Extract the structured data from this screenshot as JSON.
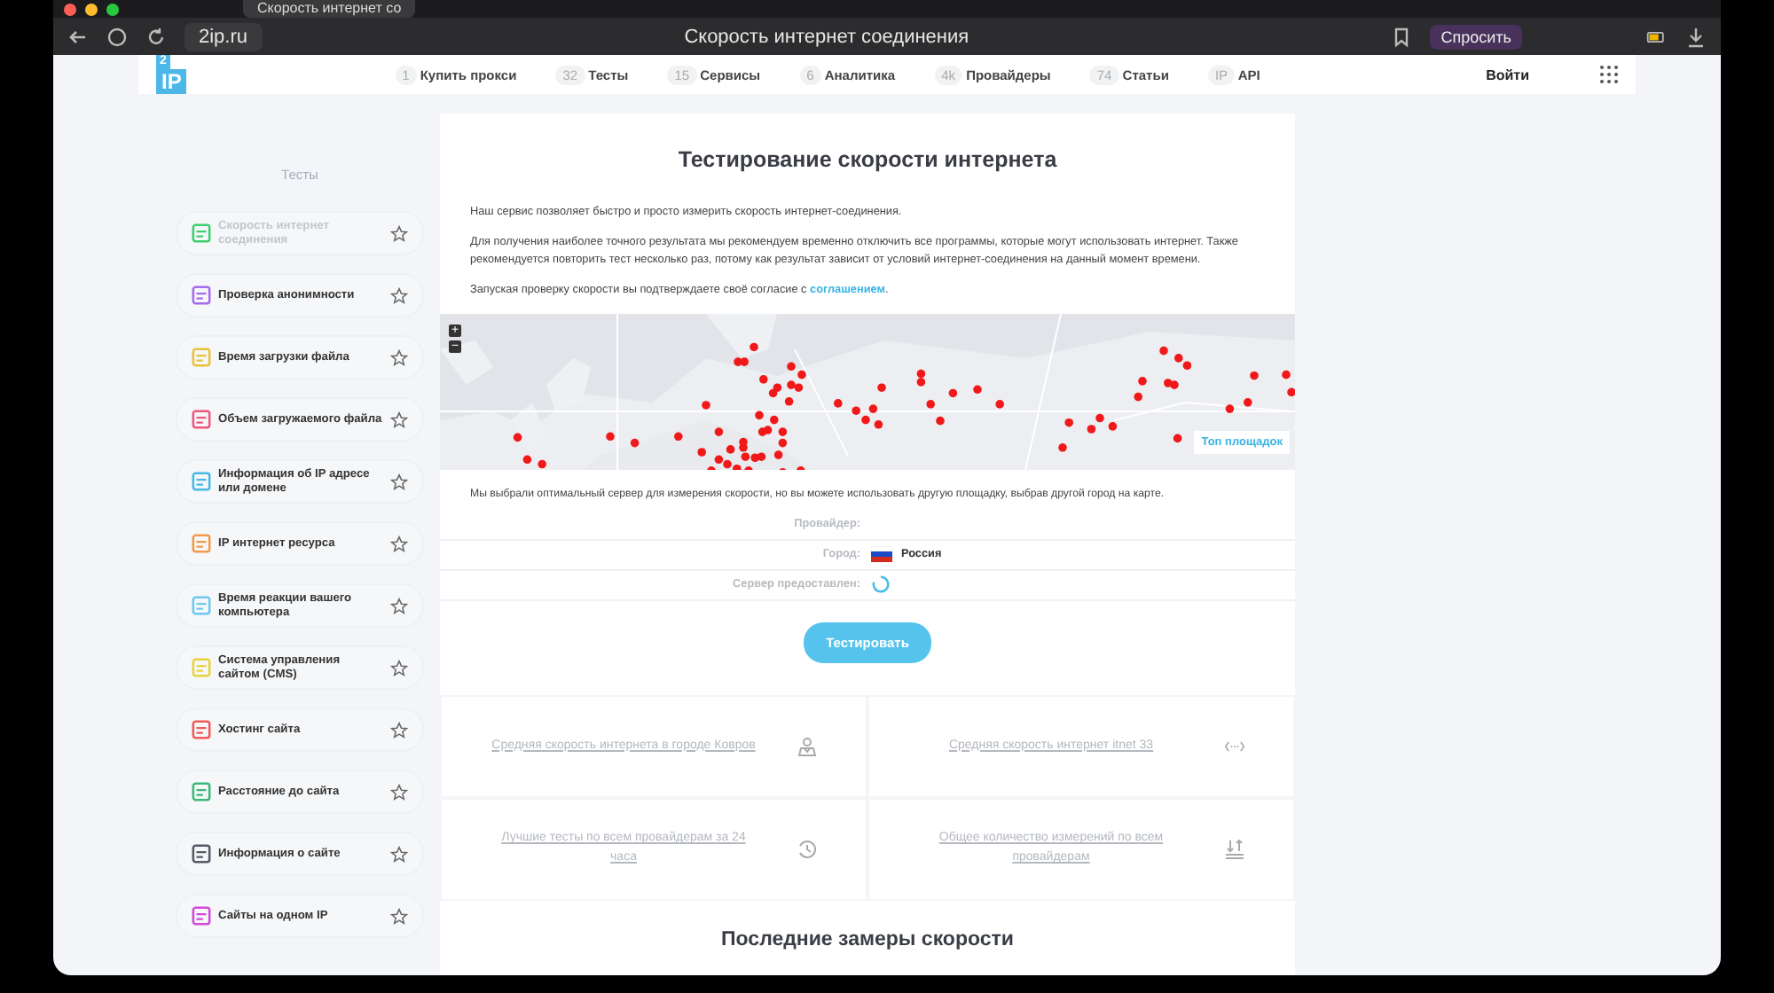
{
  "browser": {
    "tab_title": "Скорость интернет со",
    "address": "2ip.ru",
    "page_title": "Скорость интернет соединения",
    "ask_button": "Спросить"
  },
  "nav": {
    "logo": "IP",
    "logo_badge": "2",
    "items": [
      {
        "count": "1",
        "label": "Купить прокси"
      },
      {
        "count": "32",
        "label": "Тесты"
      },
      {
        "count": "15",
        "label": "Сервисы"
      },
      {
        "count": "6",
        "label": "Аналитика"
      },
      {
        "count": "4k",
        "label": "Провайдеры"
      },
      {
        "count": "74",
        "label": "Статьи"
      },
      {
        "count": "IP",
        "label": "API"
      }
    ],
    "login": "Войти"
  },
  "sidebar": {
    "heading": "Тесты",
    "items": [
      {
        "label": "Скорость интернет соединения",
        "selected": true,
        "color": "#3ccf6e"
      },
      {
        "label": "Проверка анонимности",
        "selected": false,
        "color": "#a66cf0"
      },
      {
        "label": "Время загрузки файла",
        "selected": false,
        "color": "#e8c23a"
      },
      {
        "label": "Объем загружаемого файла",
        "selected": false,
        "color": "#f0577f"
      },
      {
        "label": "Информация об IP адресе или домене",
        "selected": false,
        "color": "#46b8e6"
      },
      {
        "label": "IP интернет ресурса",
        "selected": false,
        "color": "#f29a4a"
      },
      {
        "label": "Время реакции вашего компьютера",
        "selected": false,
        "color": "#6ec8f0"
      },
      {
        "label": "Система управления сайтом (CMS)",
        "selected": false,
        "color": "#e8d43a"
      },
      {
        "label": "Хостинг сайта",
        "selected": false,
        "color": "#f05a5a"
      },
      {
        "label": "Расстояние до сайта",
        "selected": false,
        "color": "#3cb87a"
      },
      {
        "label": "Информация о сайте",
        "selected": false,
        "color": "#555a66"
      },
      {
        "label": "Сайты на одном IP",
        "selected": false,
        "color": "#d24ad8"
      }
    ]
  },
  "main": {
    "title": "Тестирование скорости интернета",
    "paragraphs": [
      "Наш сервис позволяет быстро и просто измерить скорость интернет-соединения.",
      "Для получения наиболее точного результата мы рекомендуем временно отключить все программы, которые могут использовать интернет. Также рекомендуется повторить тест несколько раз, потому как результат зависит от условий интернет-соединения на данный момент времени."
    ],
    "consent": {
      "text": "Запуская проверку скорости вы подтверждаете своё согласие с",
      "link": "соглашением",
      "end": "."
    },
    "map": {
      "zoom_in": "+",
      "zoom_out": "−",
      "top_button": "Топ площадок"
    },
    "note": "Мы выбрали оптимальный сервер для измерения скорости, но вы можете использовать другую площадку, выбрав другой город на карте.",
    "fields": [
      {
        "kind": "empty",
        "label": "Провайдер:"
      },
      {
        "kind": "flag",
        "label": "Город:",
        "value": "Россия"
      },
      {
        "kind": "spinner",
        "label": "Сервер предоставлен:"
      }
    ],
    "test_button": "Тестировать",
    "links": [
      {
        "kind": "pin",
        "label": "Средняя скорость интернета в городе Ковров"
      },
      {
        "kind": "code",
        "label": "Средняя скорость интернет itnet 33"
      },
      {
        "kind": "clock",
        "label": "Лучшие тесты по всем провайдерам за 24 часа"
      },
      {
        "kind": "arrows",
        "label": "Общее количество измерений по всем провайдерам"
      }
    ],
    "latest_heading": "Последние замеры скорости"
  }
}
